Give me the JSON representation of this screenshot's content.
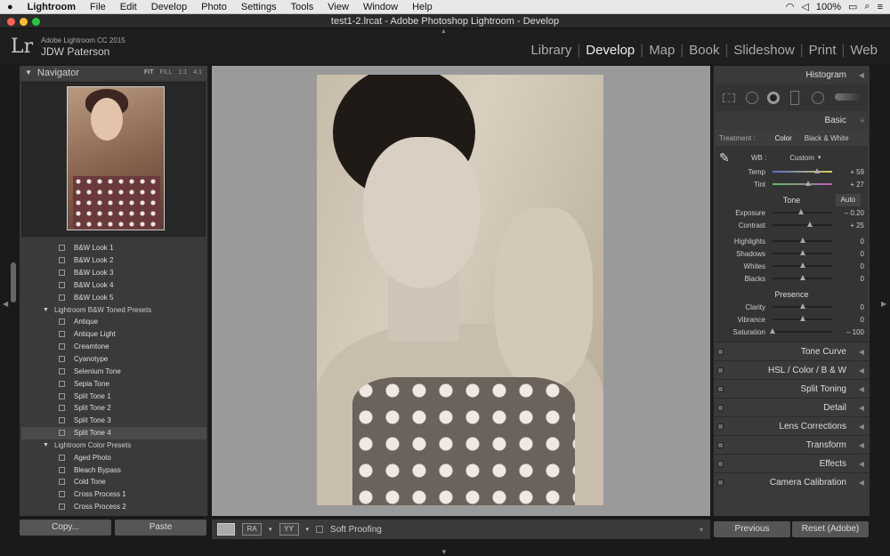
{
  "menubar": {
    "apple": "",
    "app": "Lightroom",
    "items": [
      "File",
      "Edit",
      "Develop",
      "Photo",
      "Settings",
      "Tools",
      "View",
      "Window",
      "Help"
    ],
    "battery": "100%",
    "clock": ""
  },
  "window_title": "test1-2.lrcat - Adobe Photoshop Lightroom - Develop",
  "identity": {
    "line1": "Adobe Lightroom CC 2015",
    "line2": "JDW Paterson",
    "logo": "Lr"
  },
  "modules": [
    "Library",
    "Develop",
    "Map",
    "Book",
    "Slideshow",
    "Print",
    "Web"
  ],
  "active_module": "Develop",
  "navigator": {
    "title": "Navigator",
    "options": [
      "FIT",
      "FILL",
      "1:1",
      "4:1"
    ]
  },
  "presets": [
    {
      "type": "item",
      "label": "B&W Look 1"
    },
    {
      "type": "item",
      "label": "B&W Look 2"
    },
    {
      "type": "item",
      "label": "B&W Look 3"
    },
    {
      "type": "item",
      "label": "B&W Look 4"
    },
    {
      "type": "item",
      "label": "B&W Look 5"
    },
    {
      "type": "folder",
      "label": "Lightroom B&W Toned Presets"
    },
    {
      "type": "item",
      "label": "Antique"
    },
    {
      "type": "item",
      "label": "Antique Light"
    },
    {
      "type": "item",
      "label": "Creamtone"
    },
    {
      "type": "item",
      "label": "Cyanotype"
    },
    {
      "type": "item",
      "label": "Selenium Tone"
    },
    {
      "type": "item",
      "label": "Sepia Tone"
    },
    {
      "type": "item",
      "label": "Split Tone 1"
    },
    {
      "type": "item",
      "label": "Split Tone 2"
    },
    {
      "type": "item",
      "label": "Split Tone 3"
    },
    {
      "type": "item",
      "label": "Split Tone 4",
      "selected": true
    },
    {
      "type": "folder",
      "label": "Lightroom Color Presets"
    },
    {
      "type": "item",
      "label": "Aged Photo"
    },
    {
      "type": "item",
      "label": "Bleach Bypass"
    },
    {
      "type": "item",
      "label": "Cold Tone"
    },
    {
      "type": "item",
      "label": "Cross Process 1"
    },
    {
      "type": "item",
      "label": "Cross Process 2"
    }
  ],
  "left_buttons": {
    "copy": "Copy...",
    "paste": "Paste"
  },
  "toolbar": {
    "soft_proofing": "Soft Proofing",
    "compare1": "RA",
    "compare2": "YY"
  },
  "right": {
    "histogram": "Histogram",
    "basic": "Basic",
    "treatment_label": "Treatment :",
    "treatment_color": "Color",
    "treatment_bw": "Black & White",
    "wb_label": "WB :",
    "wb_value": "Custom",
    "temp": {
      "label": "Temp",
      "value": "+ 59",
      "pos": 0.74
    },
    "tint": {
      "label": "Tint",
      "value": "+ 27",
      "pos": 0.6
    },
    "tone": "Tone",
    "auto": "Auto",
    "tone_sliders": [
      {
        "label": "Exposure",
        "value": "– 0.20",
        "pos": 0.48
      },
      {
        "label": "Contrast",
        "value": "+ 25",
        "pos": 0.62
      }
    ],
    "tone_sliders2": [
      {
        "label": "Highlights",
        "value": "0",
        "pos": 0.5
      },
      {
        "label": "Shadows",
        "value": "0",
        "pos": 0.5
      },
      {
        "label": "Whites",
        "value": "0",
        "pos": 0.5
      },
      {
        "label": "Blacks",
        "value": "0",
        "pos": 0.5
      }
    ],
    "presence": "Presence",
    "presence_sliders": [
      {
        "label": "Clarity",
        "value": "0",
        "pos": 0.5
      },
      {
        "label": "Vibrance",
        "value": "0",
        "pos": 0.5
      },
      {
        "label": "Saturation",
        "value": "– 100",
        "pos": 0.0
      }
    ],
    "collapsed": [
      "Tone Curve",
      "HSL / Color / B & W",
      "Split Toning",
      "Detail",
      "Lens Corrections",
      "Transform",
      "Effects",
      "Camera Calibration"
    ],
    "previous": "Previous",
    "reset": "Reset (Adobe)"
  },
  "colors": {
    "accent": "#dddddd",
    "panel": "#3a3a3a",
    "background": "#1a1a1a"
  }
}
